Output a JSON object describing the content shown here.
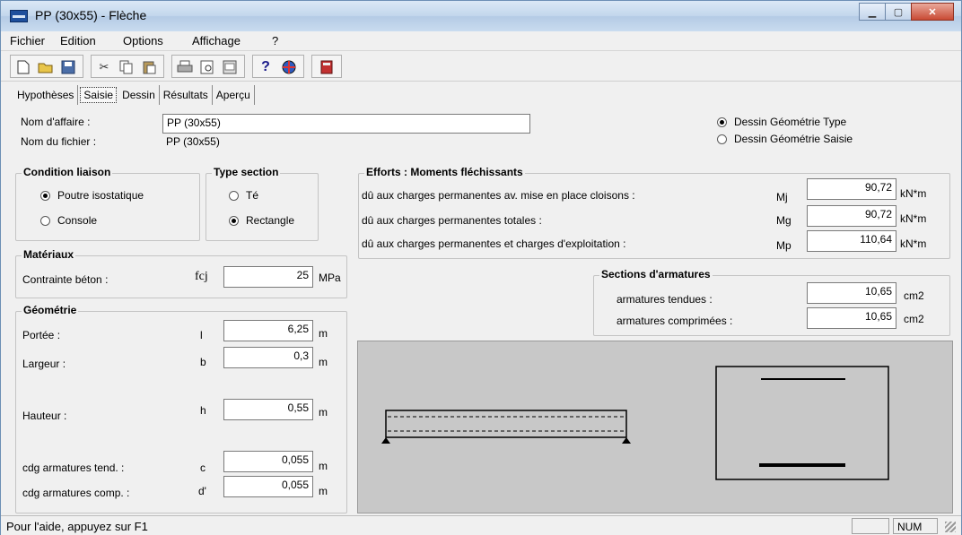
{
  "window": {
    "title": "PP (30x55) - Flèche"
  },
  "menu": [
    "Fichier",
    "Edition",
    "Options",
    "Affichage",
    "?"
  ],
  "tabs": [
    "Hypothèses",
    "Saisie",
    "Dessin",
    "Résultats",
    "Aperçu"
  ],
  "affaire": {
    "nom_label": "Nom d'affaire :",
    "nom_value": "PP (30x55)",
    "fichier_label": "Nom du fichier :",
    "fichier_value": "PP (30x55)"
  },
  "dessin_options": [
    "Dessin Géométrie Type",
    "Dessin Géométrie Saisie"
  ],
  "condition": {
    "title": "Condition liaison",
    "options": [
      "Poutre isostatique",
      "Console"
    ]
  },
  "type_section": {
    "title": "Type section",
    "options": [
      "Té",
      "Rectangle"
    ]
  },
  "materiaux": {
    "title": "Matériaux",
    "label": "Contrainte béton :",
    "symbol": "fcj",
    "value": "25",
    "unit": "MPa"
  },
  "geometrie": {
    "title": "Géométrie",
    "rows": [
      {
        "label": "Portée :",
        "symbol": "l",
        "value": "6,25",
        "unit": "m"
      },
      {
        "label": "Largeur :",
        "symbol": "b",
        "value": "0,3",
        "unit": "m"
      },
      {
        "label": "Hauteur :",
        "symbol": "h",
        "value": "0,55",
        "unit": "m"
      },
      {
        "label": "cdg armatures tend. :",
        "symbol": "c",
        "value": "0,055",
        "unit": "m"
      },
      {
        "label": "cdg armatures comp. :",
        "symbol": "d'",
        "value": "0,055",
        "unit": "m"
      }
    ]
  },
  "efforts": {
    "title": "Efforts : Moments fléchissants",
    "rows": [
      {
        "label": "dû aux charges permanentes av. mise en place cloisons :",
        "symbol": "Mj",
        "value": "90,72",
        "unit": "kN*m"
      },
      {
        "label": "dû aux charges permanentes totales :",
        "symbol": "Mg",
        "value": "90,72",
        "unit": "kN*m"
      },
      {
        "label": "dû aux charges permanentes et charges d'exploitation :",
        "symbol": "Mp",
        "value": "110,64",
        "unit": "kN*m"
      }
    ]
  },
  "sections": {
    "title": "Sections d'armatures",
    "rows": [
      {
        "label": "armatures tendues :",
        "value": "10,65",
        "unit": "cm2"
      },
      {
        "label": "armatures comprimées :",
        "value": "10,65",
        "unit": "cm2"
      }
    ]
  },
  "status": {
    "help": "Pour l'aide, appuyez sur F1",
    "num": "NUM"
  }
}
